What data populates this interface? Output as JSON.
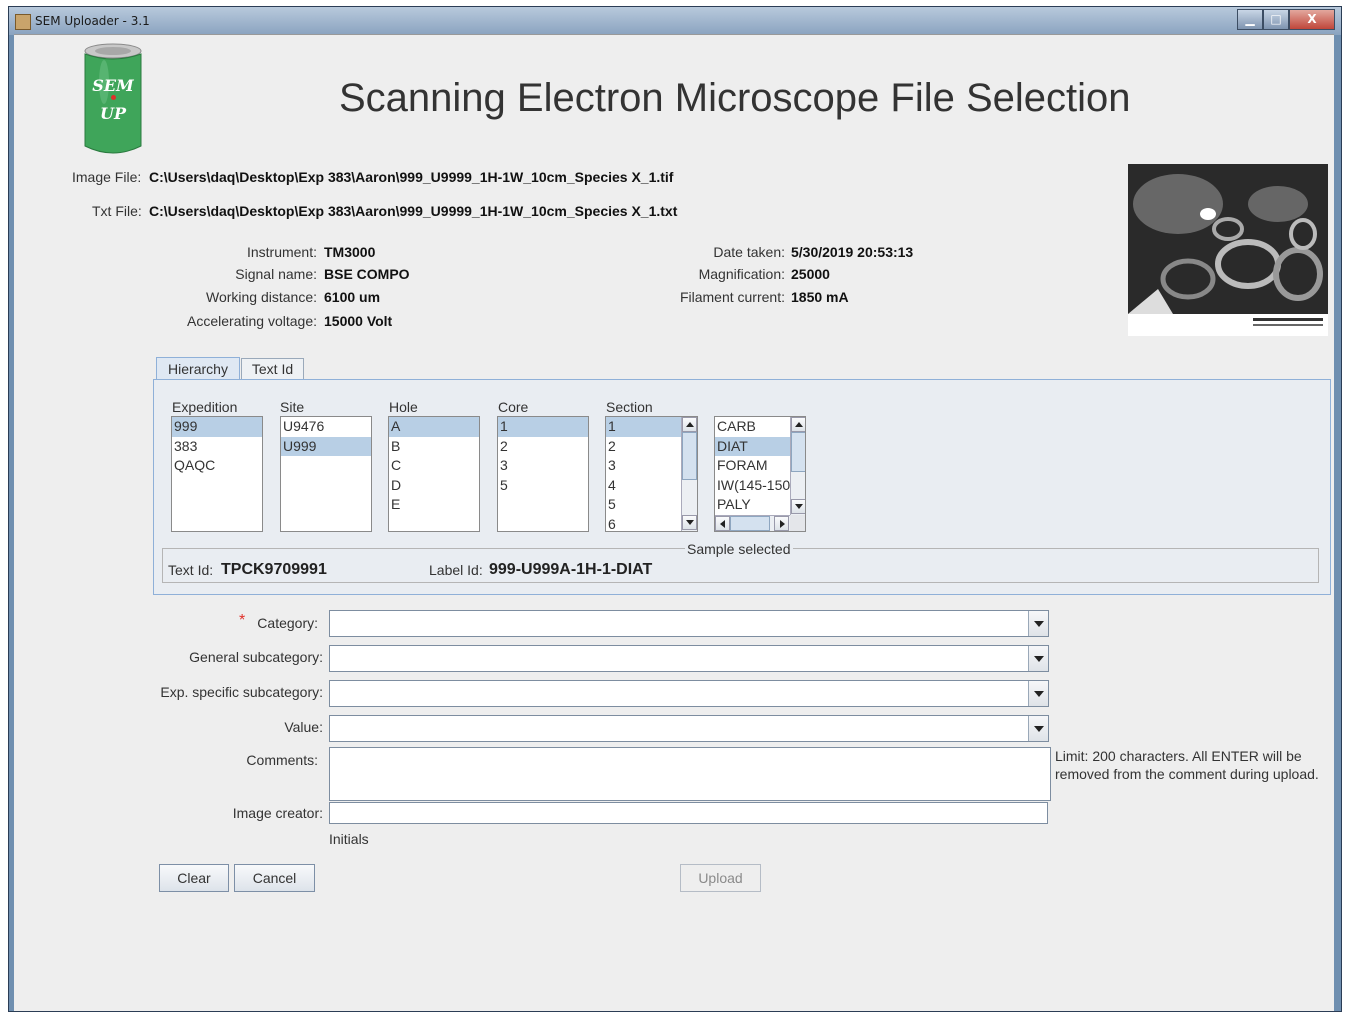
{
  "window": {
    "title": "SEM Uploader - 3.1",
    "minimize": "▁",
    "maximize": "□",
    "close": "X"
  },
  "logo": {
    "line1": "SEM",
    "line2": "UP"
  },
  "header": {
    "title": "Scanning Electron Microscope File Selection"
  },
  "files": {
    "image_label": "Image File:",
    "image_value": "C:\\Users\\daq\\Desktop\\Exp 383\\Aaron\\999_U9999_1H-1W_10cm_Species X_1.tif",
    "txt_label": "Txt File:",
    "txt_value": "C:\\Users\\daq\\Desktop\\Exp 383\\Aaron\\999_U9999_1H-1W_10cm_Species X_1.txt"
  },
  "meta": {
    "instrument_label": "Instrument:",
    "instrument": "TM3000",
    "signal_label": "Signal name:",
    "signal": "BSE COMPO",
    "wd_label": "Working distance:",
    "wd": "6100 um",
    "av_label": "Accelerating voltage:",
    "av": "15000 Volt",
    "date_label": "Date taken:",
    "date": "5/30/2019 20:53:13",
    "mag_label": "Magnification:",
    "mag": "25000",
    "fil_label": "Filament current:",
    "fil": "1850 mA"
  },
  "tabs": [
    {
      "label": "Hierarchy"
    },
    {
      "label": "Text Id"
    }
  ],
  "hierarchy": {
    "expedition": {
      "header": "Expedition",
      "items": [
        "999",
        "383",
        "QAQC"
      ]
    },
    "site": {
      "header": "Site",
      "items": [
        "U9476",
        "U999"
      ]
    },
    "hole": {
      "header": "Hole",
      "items": [
        "A",
        "B",
        "C",
        "D",
        "E"
      ]
    },
    "core": {
      "header": "Core",
      "items": [
        "1",
        "2",
        "3",
        "5"
      ]
    },
    "section": {
      "header": "Section",
      "items": [
        "1",
        "2",
        "3",
        "4",
        "5",
        "6"
      ]
    },
    "sample_type": {
      "items": [
        "CARB",
        "DIAT",
        "FORAM",
        "IW(145-150",
        "PALY"
      ]
    }
  },
  "sample": {
    "legend": "Sample selected",
    "text_id_label": "Text Id:",
    "text_id": "TPCK9709991",
    "label_id_label": "Label Id:",
    "label_id": "999-U999A-1H-1-DIAT"
  },
  "form": {
    "required_mark": "*",
    "category_label": "Category:",
    "general_label": "General subcategory:",
    "exp_label": "Exp. specific subcategory:",
    "value_label": "Value:",
    "comments_label": "Comments:",
    "comments_hint": "Limit: 200 characters. All ENTER will be removed from the comment during upload.",
    "creator_label": "Image creator:",
    "initials": "Initials",
    "clear": "Clear",
    "cancel": "Cancel",
    "upload": "Upload"
  },
  "colors": {
    "selection": "#b8cfe5",
    "panel_border": "#8fb0d8",
    "logo_green": "#3fa55a"
  }
}
